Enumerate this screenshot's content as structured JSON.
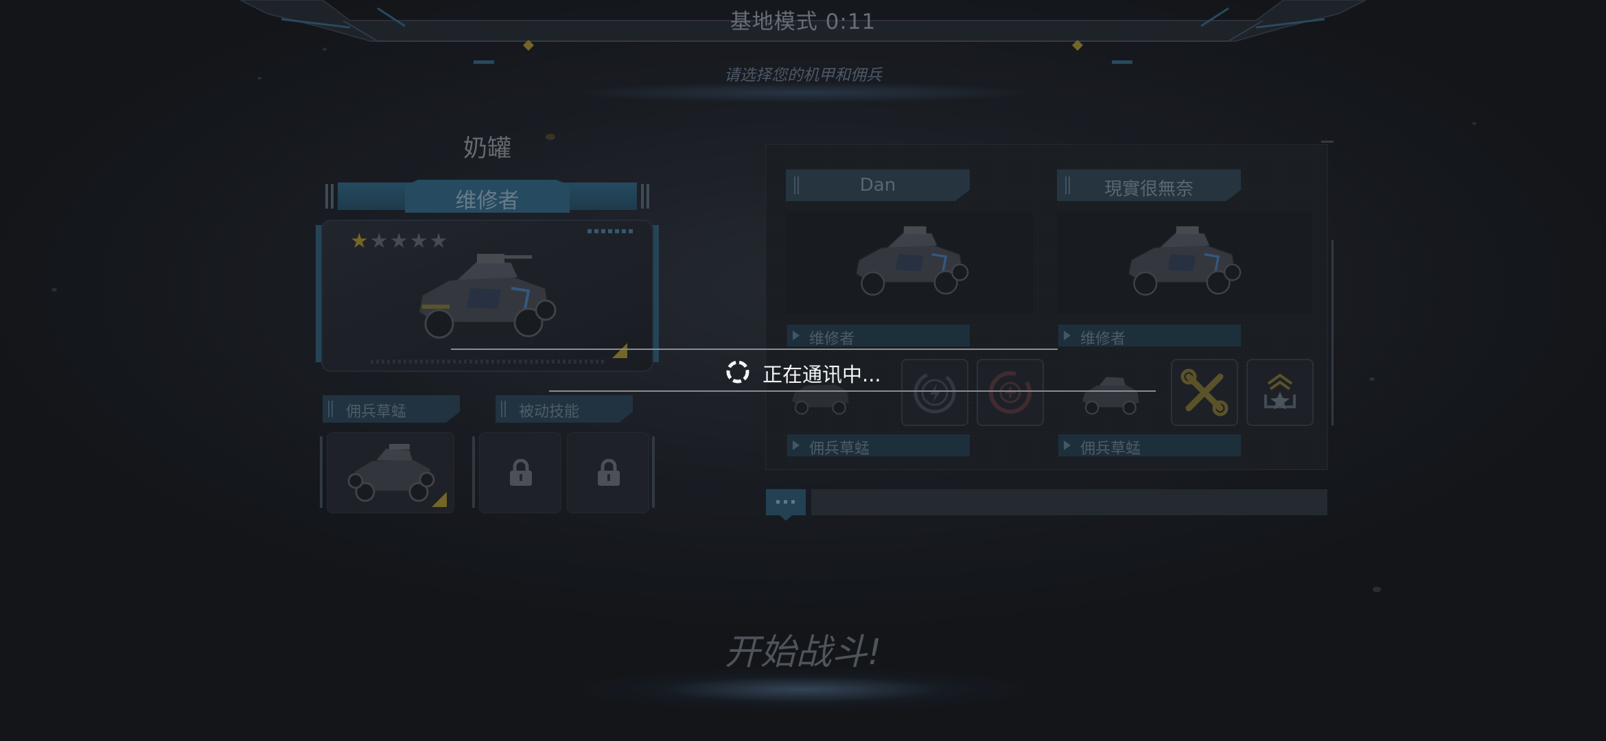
{
  "header": {
    "mode_title": "基地模式 0:11",
    "prompt": "请选择您的机甲和佣兵"
  },
  "player": {
    "name": "奶罐",
    "mech_class": "维修者",
    "stars_total": 5,
    "stars_filled": 1,
    "mercenary_section_label": "佣兵草蜢",
    "passive_section_label": "被动技能",
    "passive_slots": [
      "locked",
      "locked"
    ],
    "icons": {
      "star": "star-icon",
      "lock": "lock-icon",
      "rank_corner": "corner-triangle-icon"
    }
  },
  "teammates": [
    {
      "name": "Dan",
      "mech_class": "维修者",
      "mercenary": "佣兵草蜢",
      "skills": [
        "lightning-skill-icon",
        "repair-cycle-skill-icon"
      ]
    },
    {
      "name": "現實很無奈",
      "mech_class": "维修者",
      "mercenary": "佣兵草蜢",
      "skills": [
        "wrench-screwdriver-skill-icon",
        "rank-up-star-skill-icon"
      ]
    }
  ],
  "chat": {
    "button_icon": "chat-dots-icon",
    "input_value": ""
  },
  "start_button": {
    "label": "开始战斗!"
  },
  "loading": {
    "text": "正在通讯中...",
    "spinner_icon": "loading-spinner-icon"
  },
  "colors": {
    "accent_blue": "#2c5870",
    "star_gold": "#8a7a2c",
    "background": "#1d2127"
  }
}
